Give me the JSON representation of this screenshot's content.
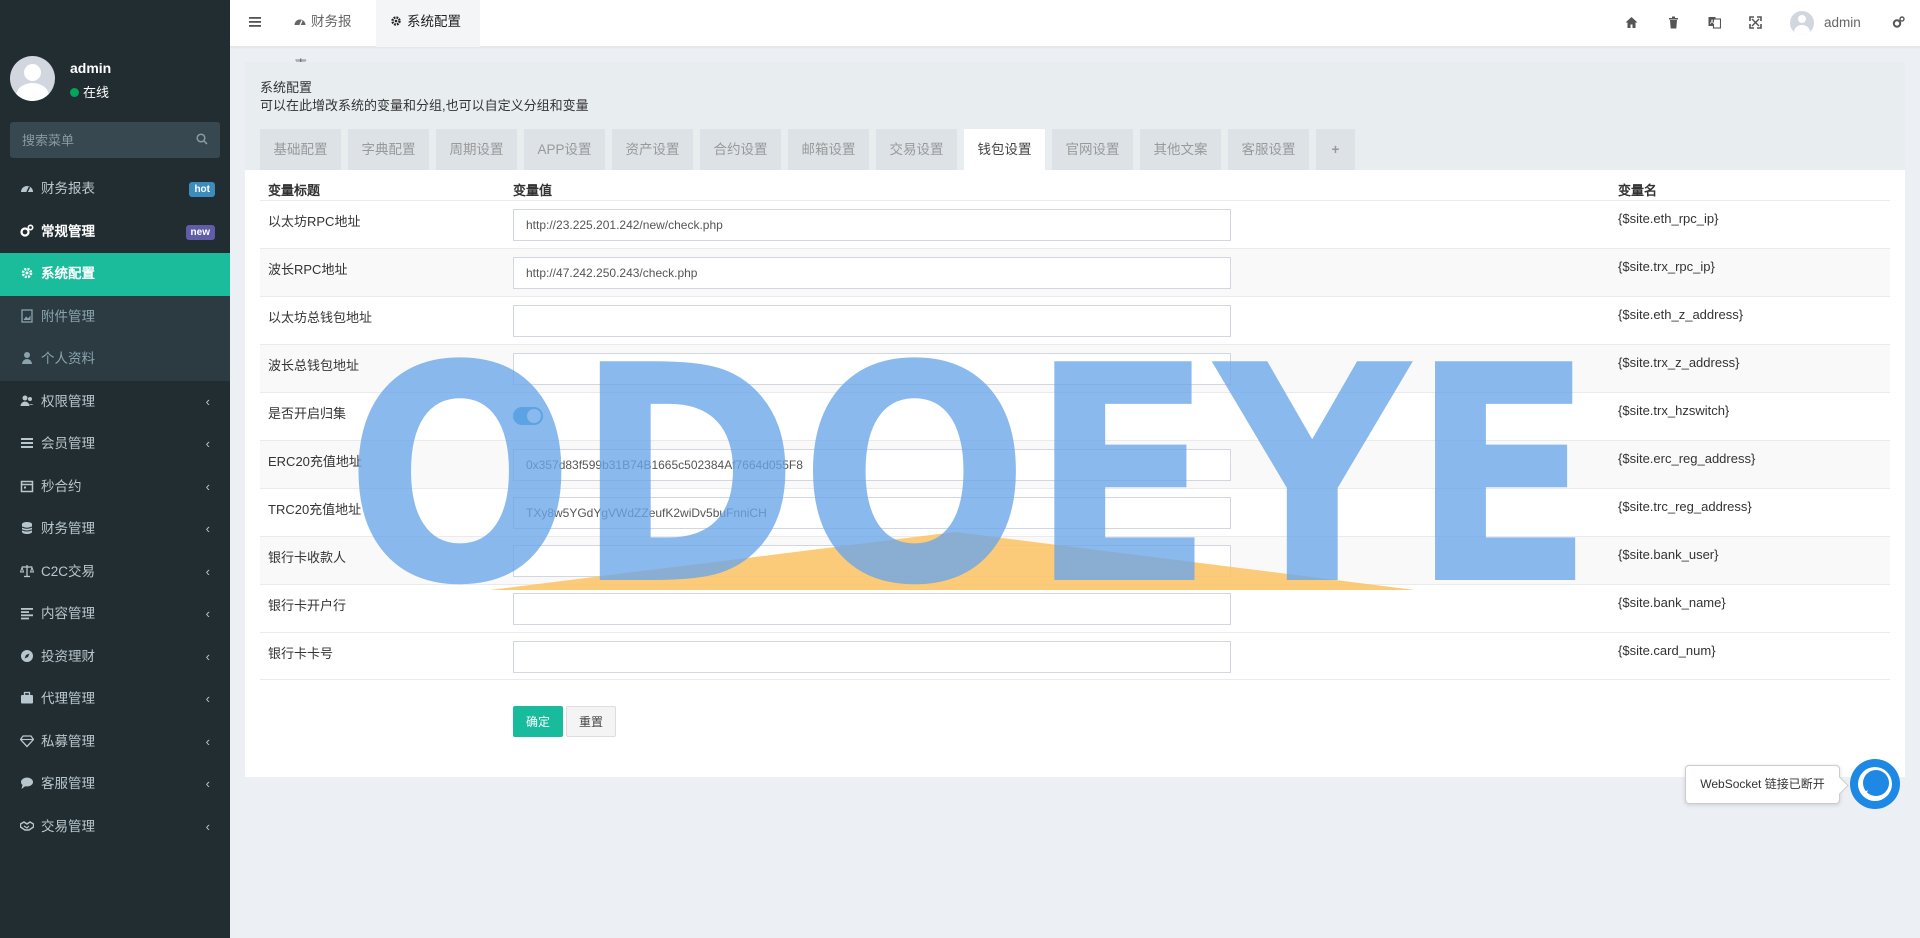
{
  "user": {
    "name": "admin",
    "status": "在线"
  },
  "search": {
    "placeholder": "搜索菜单"
  },
  "menu": {
    "items": [
      {
        "label": "财务报表",
        "badge": "hot",
        "badge_color": "#3c8dbc",
        "icon": "dashboard-icon"
      },
      {
        "label": "常规管理",
        "badge": "new",
        "badge_color": "#605ca8",
        "icon": "cogs-icon"
      },
      {
        "label": "系统配置",
        "icon": "gear-icon"
      },
      {
        "label": "附件管理",
        "icon": "file-image-icon"
      },
      {
        "label": "个人资料",
        "icon": "user-icon"
      },
      {
        "label": "权限管理",
        "icon": "users-icon"
      },
      {
        "label": "会员管理",
        "icon": "list-icon"
      },
      {
        "label": "秒合约",
        "icon": "calendar-icon"
      },
      {
        "label": "财务管理",
        "icon": "database-icon"
      },
      {
        "label": "C2C交易",
        "icon": "balance-scale-icon"
      },
      {
        "label": "内容管理",
        "icon": "align-left-icon"
      },
      {
        "label": "投资理财",
        "icon": "compass-icon"
      },
      {
        "label": "代理管理",
        "icon": "briefcase-icon"
      },
      {
        "label": "私募管理",
        "icon": "diamond-icon"
      },
      {
        "label": "客服管理",
        "icon": "comment-icon"
      },
      {
        "label": "交易管理",
        "icon": "handshake-icon"
      }
    ]
  },
  "header": {
    "tabs": [
      {
        "label": "财务报表"
      },
      {
        "label": "系统配置"
      }
    ],
    "user": "admin"
  },
  "page": {
    "title": "系统配置",
    "description": "可以在此增改系统的变量和分组,也可以自定义分组和变量",
    "tabs": [
      "基础配置",
      "字典配置",
      "周期设置",
      "APP设置",
      "资产设置",
      "合约设置",
      "邮箱设置",
      "交易设置",
      "钱包设置",
      "官网设置",
      "其他文案",
      "客服设置",
      "+"
    ],
    "active_tab": "钱包设置"
  },
  "table": {
    "headers": {
      "title": "变量标题",
      "value": "变量值",
      "name": "变量名"
    },
    "rows": [
      {
        "label": "以太坊RPC地址",
        "value": "http://23.225.201.242/new/check.php",
        "var": "{$site.eth_rpc_ip}"
      },
      {
        "label": "波长RPC地址",
        "value": "http://47.242.250.243/check.php",
        "var": "{$site.trx_rpc_ip}"
      },
      {
        "label": "以太坊总钱包地址",
        "value": "",
        "var": "{$site.eth_z_address}"
      },
      {
        "label": "波长总钱包地址",
        "value": "",
        "var": "{$site.trx_z_address}"
      },
      {
        "label": "是否开启归集",
        "value": "on",
        "var": "{$site.trx_hzswitch}"
      },
      {
        "label": "ERC20充值地址",
        "value": "0x357d83f599b31B74B1665c502384Af7664d055F8",
        "var": "{$site.erc_reg_address}"
      },
      {
        "label": "TRC20充值地址",
        "value": "TXy8w5YGdYgVWdZZeufK2wiDv5buFnniCH",
        "var": "{$site.trc_reg_address}"
      },
      {
        "label": "银行卡收款人",
        "value": "",
        "var": "{$site.bank_user}"
      },
      {
        "label": "银行卡开户行",
        "value": "",
        "var": "{$site.bank_name}"
      },
      {
        "label": "银行卡卡号",
        "value": "",
        "var": "{$site.card_num}"
      }
    ]
  },
  "buttons": {
    "confirm": "确定",
    "reset": "重置"
  },
  "watermark": "ODOEYE",
  "notification": {
    "text": "WebSocket 链接已断开"
  },
  "colors": {
    "accent": "#18bc9c",
    "sidebar_bg": "#222d32",
    "watermark_blue": "#6aa6ea",
    "watermark_orange": "#fbc56a"
  }
}
